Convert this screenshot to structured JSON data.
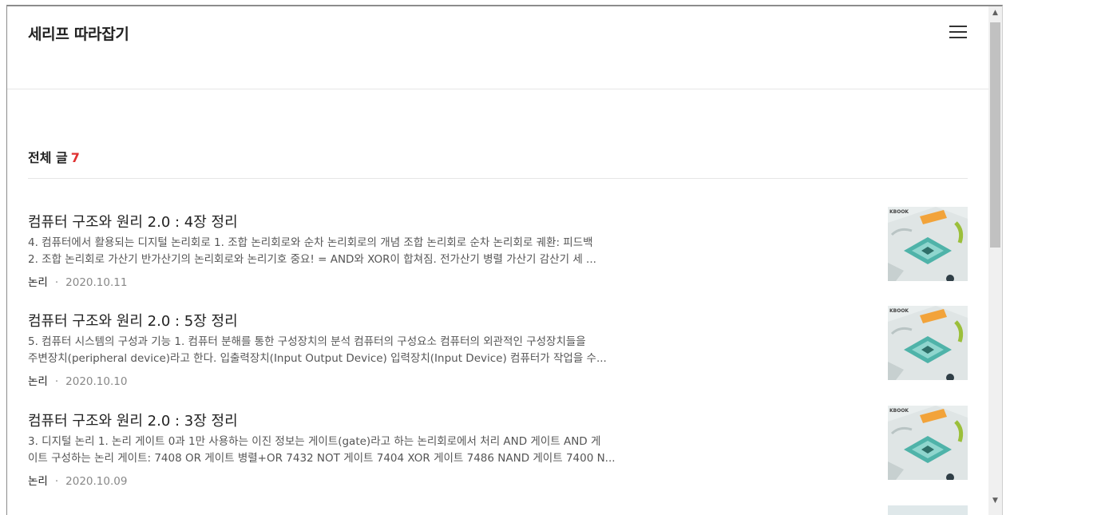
{
  "header": {
    "blog_title": "세리프 따라잡기",
    "menu_icon": "hamburger-menu-icon"
  },
  "section": {
    "title": "전체 글",
    "count": "7"
  },
  "posts": [
    {
      "title": "컴퓨터 구조와 원리 2.0 : 4장 정리",
      "summary_line1": "4. 컴퓨터에서 활용되는 디지털 논리회로 1. 조합 논리회로와 순차 논리회로의 개념 조합 논리회로 순차 논리회로 궤환: 피드백",
      "summary_line2": "2. 조합 논리회로 가산기 반가산기의 논리회로와 논리기호 중요! = AND와 XOR이 합쳐짐. 전가산기 병렬 가산기 감산기 세 ...",
      "category": "논리",
      "separator": "·",
      "date": "2020.10.11"
    },
    {
      "title": "컴퓨터 구조와 원리 2.0 : 5장 정리",
      "summary_line1": "5. 컴퓨터 시스템의 구성과 기능 1. 컴퓨터 분해를 통한 구성장치의 분석 컴퓨터의 구성요소 컴퓨터의 외관적인 구성장치들을",
      "summary_line2": "주변장치(peripheral device)라고 한다. 입출력장치(Input Output Device) 입력장치(Input Device) 컴퓨터가 작업을 수...",
      "category": "논리",
      "separator": "·",
      "date": "2020.10.10"
    },
    {
      "title": "컴퓨터 구조와 원리 2.0 : 3장 정리",
      "summary_line1": "3. 디지털 논리 1. 논리 게이트 0과 1만 사용하는 이진 정보는 게이트(gate)라고 하는 논리회로에서 처리 AND 게이트 AND 게",
      "summary_line2": "이트 구성하는 논리 게이트: 7408 OR 게이트 병렬+OR 7432 NOT 게이트 7404 XOR 게이트 7486 NAND 게이트 7400 N...",
      "category": "논리",
      "separator": "·",
      "date": "2020.10.09"
    }
  ],
  "scrollbar": {
    "up_icon": "▲",
    "down_icon": "▼"
  }
}
